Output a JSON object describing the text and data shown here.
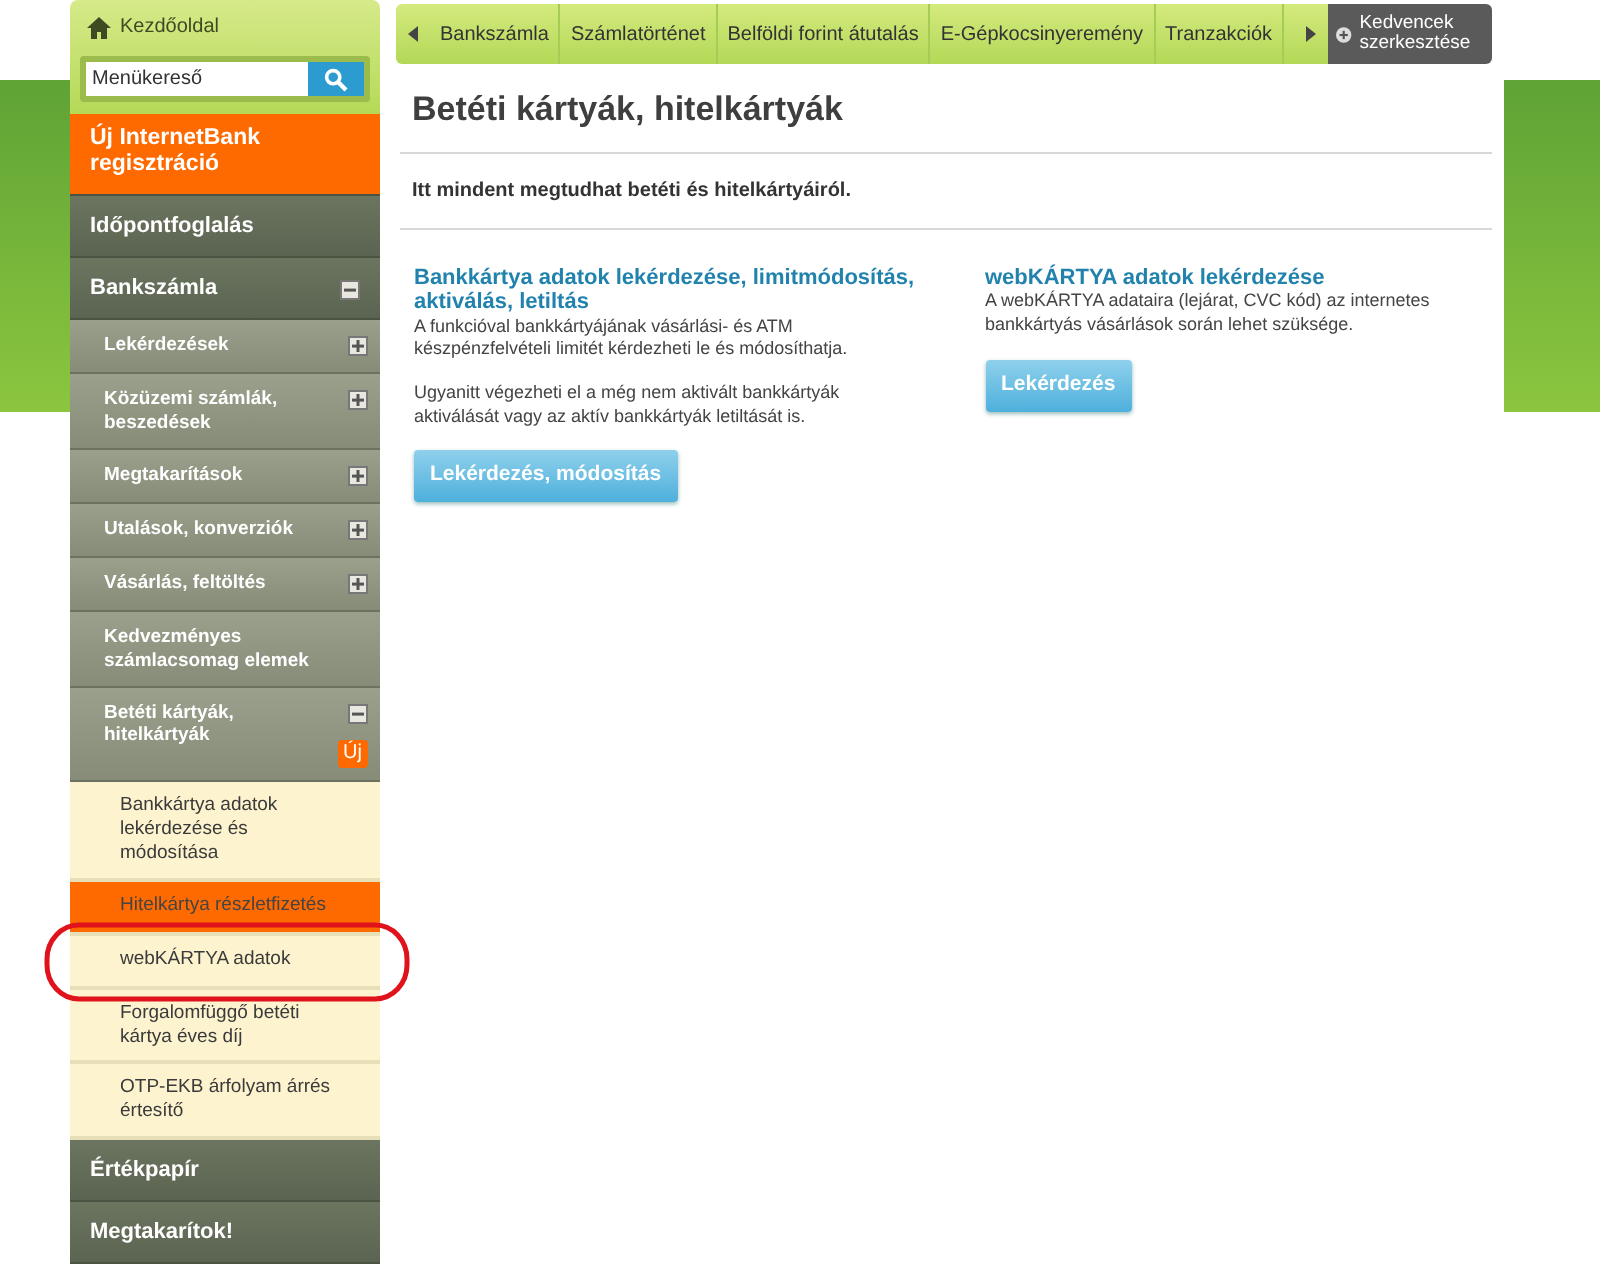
{
  "sidebar": {
    "home": "Kezdőoldal",
    "search": {
      "placeholder": "Menükereső"
    },
    "items": [
      {
        "label": "Új InternetBank regisztráció",
        "kind": "promo"
      },
      {
        "label": "Időpontfoglalás",
        "kind": "section"
      },
      {
        "label": "Bankszámla",
        "kind": "section",
        "expanded": true,
        "children": [
          {
            "label": "Lekérdezések",
            "expanded": false
          },
          {
            "label": "Közüzemi számlák, beszedések",
            "expanded": false
          },
          {
            "label": "Megtakarítások",
            "expanded": false
          },
          {
            "label": "Utalások, konverziók",
            "expanded": false
          },
          {
            "label": "Vásárlás, feltöltés",
            "expanded": false
          },
          {
            "label": "Kedvezményes számlacsomag elemek"
          },
          {
            "label": "Betéti kártyák, hitelkártyák",
            "expanded": true,
            "badge": "Új",
            "children": [
              {
                "label": "Bankkártya adatok lekérdezése és módosítása",
                "selected": false,
                "highlighted": false
              },
              {
                "label": "Hitelkártya részletfizetés",
                "selected": true,
                "highlighted": false
              },
              {
                "label": "webKÁRTYA adatok",
                "selected": false,
                "highlighted": true
              },
              {
                "label": "Forgalomfüggő betéti kártya éves díj",
                "selected": false,
                "highlighted": false
              },
              {
                "label": "OTP-EKB árfolyam árrés értesítő",
                "selected": false,
                "highlighted": false
              }
            ]
          }
        ]
      },
      {
        "label": "Értékpapír",
        "kind": "section"
      },
      {
        "label": "Megtakarítok!",
        "kind": "section"
      }
    ]
  },
  "favorites": {
    "tabs": [
      "Bankszámla",
      "Számlatörténet",
      "Belföldi forint átutalás",
      "E-Gépkocsinyeremény",
      "Tranzakciók"
    ],
    "edit_button": "Kedvencek szerkesztése"
  },
  "page": {
    "title": "Betéti kártyák, hitelkártyák",
    "intro": "Itt mindent megtudhat betéti és hitelkártyáiról.",
    "sections": [
      {
        "heading": "Bankkártya adatok lekérdezése, limitmódosítás, aktiválás, letiltás",
        "paragraphs": [
          "A funkcióval bankkártyájának vásárlási- és ATM készpénzfelvételi limitét kérdezheti le és módosíthatja.",
          "Ugyanitt végezheti el a még nem aktivált bankkártyák aktiválását vagy az aktív bankkártyák letiltását is."
        ],
        "button": "Lekérdezés, módosítás"
      },
      {
        "heading": "webKÁRTYA adatok lekérdezése",
        "paragraphs": [
          "A webKÁRTYA adataira (lejárat, CVC kód) az internetes bankkártyás vásárlások során lehet szüksége."
        ],
        "button": "Lekérdezés"
      }
    ]
  }
}
